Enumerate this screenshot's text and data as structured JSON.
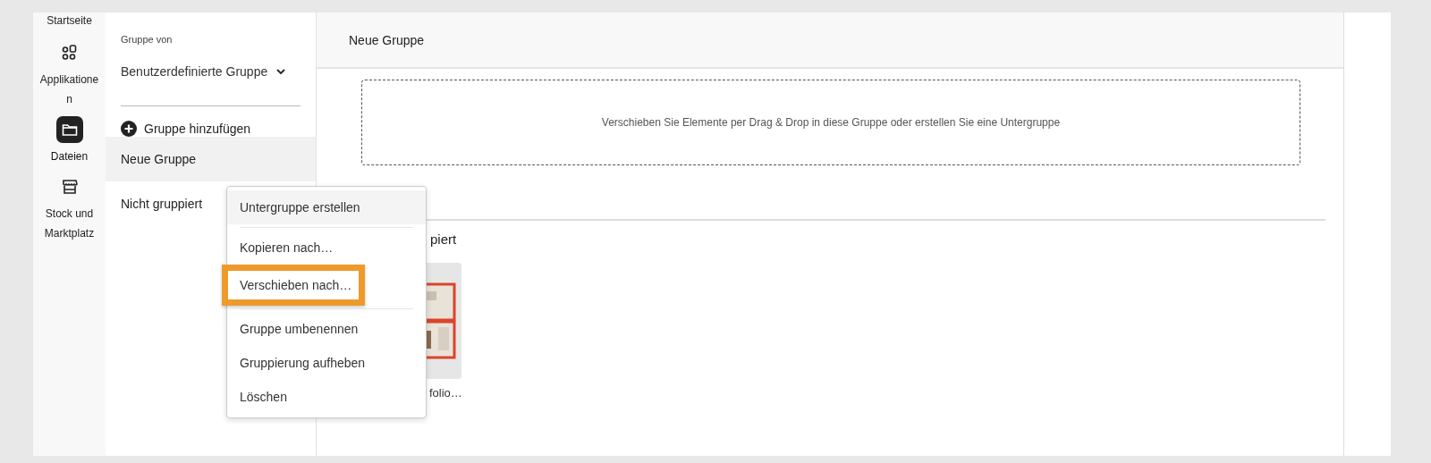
{
  "rail": [
    {
      "label": "Startseite",
      "selected": false
    },
    {
      "label": "Applikationen",
      "selected": false
    },
    {
      "label": "Dateien",
      "selected": true
    },
    {
      "label": "Stock und Marktplatz",
      "selected": false
    }
  ],
  "group_panel": {
    "label": "Gruppe von",
    "dropdown": "Benutzerdefinierte Gruppe",
    "add_button": "Gruppe hinzufügen",
    "groups": [
      {
        "label": "Neue Gruppe",
        "selected": true
      },
      {
        "label": "Nicht gruppiert",
        "selected": false
      }
    ]
  },
  "main": {
    "title": "Neue Gruppe",
    "drop_hint": "Verschieben Sie Elemente per Drag & Drop in diese Gruppe oder erstellen Sie eine Untergruppe",
    "section_heading": "piert",
    "file_caption": "folio…"
  },
  "context_menu": [
    {
      "label": "Untergruppe erstellen",
      "hovered": true,
      "highlighted": false,
      "divider_after": true
    },
    {
      "label": "Kopieren nach…",
      "hovered": false,
      "highlighted": false,
      "divider_after": false
    },
    {
      "label": "Verschieben nach…",
      "hovered": false,
      "highlighted": true,
      "divider_after": true
    },
    {
      "label": "Gruppe umbenennen",
      "hovered": false,
      "highlighted": false,
      "divider_after": false
    },
    {
      "label": "Gruppierung aufheben",
      "hovered": false,
      "highlighted": false,
      "divider_after": false
    },
    {
      "label": "Löschen",
      "hovered": false,
      "highlighted": false,
      "divider_after": false
    }
  ]
}
